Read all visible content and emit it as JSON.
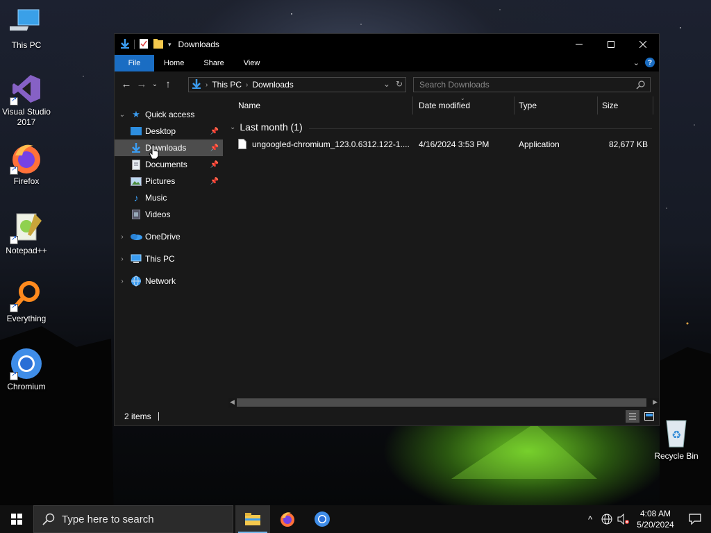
{
  "desktop": {
    "icons": [
      {
        "label": "This PC",
        "icon": "computer-icon"
      },
      {
        "label": "Visual Studio\n2017",
        "icon": "visual-studio-icon"
      },
      {
        "label": "Firefox",
        "icon": "firefox-icon"
      },
      {
        "label": "Notepad++",
        "icon": "notepadpp-icon"
      },
      {
        "label": "Everything",
        "icon": "everything-search-icon"
      },
      {
        "label": "Chromium",
        "icon": "chromium-icon"
      }
    ],
    "recycle_bin": {
      "label": "Recycle Bin",
      "icon": "recycle-bin-icon"
    }
  },
  "window": {
    "title": "Downloads",
    "ribbon_tabs": [
      "File",
      "Home",
      "Share",
      "View"
    ],
    "address": {
      "crumbs": [
        "This PC",
        "Downloads"
      ]
    },
    "search": {
      "placeholder": "Search Downloads"
    },
    "nav": {
      "quick_access": "Quick access",
      "items": [
        {
          "label": "Desktop",
          "icon": "desktop-folder-icon",
          "pinned": true
        },
        {
          "label": "Downloads",
          "icon": "downloads-folder-icon",
          "pinned": true,
          "selected": true
        },
        {
          "label": "Documents",
          "icon": "documents-folder-icon",
          "pinned": true
        },
        {
          "label": "Pictures",
          "icon": "pictures-folder-icon",
          "pinned": true
        },
        {
          "label": "Music",
          "icon": "music-folder-icon"
        },
        {
          "label": "Videos",
          "icon": "videos-folder-icon"
        }
      ],
      "roots": [
        {
          "label": "OneDrive",
          "icon": "onedrive-icon"
        },
        {
          "label": "This PC",
          "icon": "this-pc-icon"
        },
        {
          "label": "Network",
          "icon": "network-icon"
        }
      ]
    },
    "columns": [
      "Name",
      "Date modified",
      "Type",
      "Size"
    ],
    "group_label": "Last month (1)",
    "files": [
      {
        "name": "ungoogled-chromium_123.0.6312.122-1....",
        "date": "4/16/2024 3:53 PM",
        "type": "Application",
        "size": "82,677 KB"
      }
    ],
    "status": "2 items"
  },
  "taskbar": {
    "search_placeholder": "Type here to search",
    "apps": [
      "file-explorer-icon",
      "firefox-icon",
      "chromium-icon"
    ],
    "time": "4:08 AM",
    "date": "5/20/2024"
  },
  "colors": {
    "accent": "#1a6dc3",
    "selection": "#4d4d4d",
    "window_bg": "#191919"
  }
}
